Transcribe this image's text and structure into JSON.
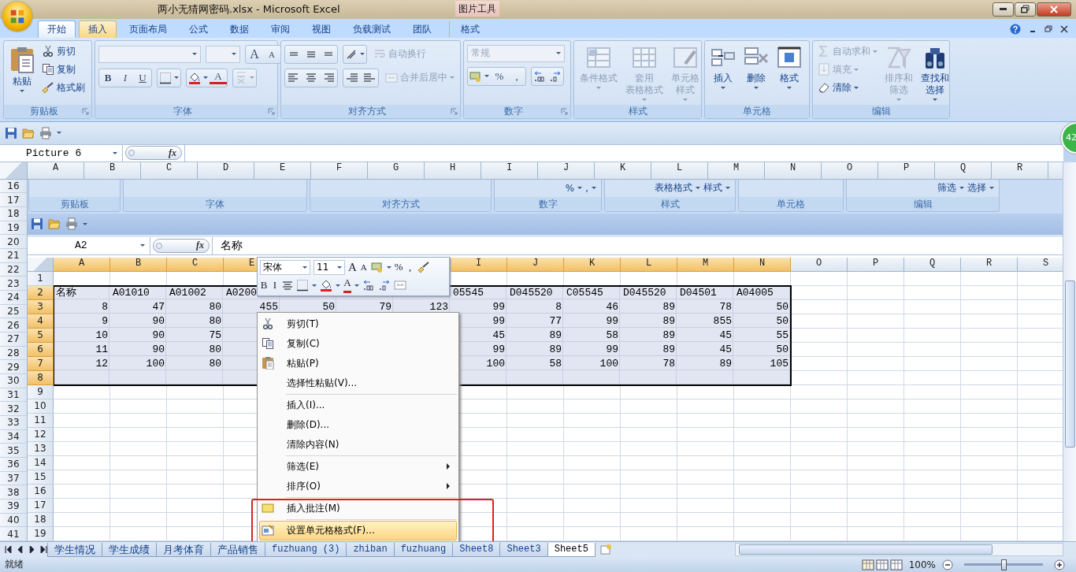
{
  "title_bar": {
    "title": "两小无猜网密码.xlsx - Microsoft Excel",
    "tool_label": "图片工具"
  },
  "tabs": [
    {
      "label": "开始",
      "selected": true,
      "hovered": false,
      "kind": "standard"
    },
    {
      "label": "插入",
      "selected": false,
      "hovered": true,
      "kind": "standard"
    },
    {
      "label": "页面布局",
      "selected": false,
      "hovered": false,
      "kind": "standard"
    },
    {
      "label": "公式",
      "selected": false,
      "hovered": false,
      "kind": "standard"
    },
    {
      "label": "数据",
      "selected": false,
      "hovered": false,
      "kind": "standard"
    },
    {
      "label": "审阅",
      "selected": false,
      "hovered": false,
      "kind": "standard"
    },
    {
      "label": "视图",
      "selected": false,
      "hovered": false,
      "kind": "standard"
    },
    {
      "label": "负载测试",
      "selected": false,
      "hovered": false,
      "kind": "standard"
    },
    {
      "label": "团队",
      "selected": false,
      "hovered": false,
      "kind": "standard"
    },
    {
      "label": "格式",
      "selected": false,
      "hovered": false,
      "kind": "contextual"
    }
  ],
  "ribbon": {
    "clipboard": {
      "label": "剪贴板",
      "paste": "粘贴",
      "items": [
        "剪切",
        "复制",
        "格式刷"
      ]
    },
    "font": {
      "label": "字体",
      "grow": "A",
      "shrink": "A",
      "bold": "B",
      "italic": "I",
      "underline": "U",
      "font_color_glyph": "A"
    },
    "alignment": {
      "label": "对齐方式",
      "buttons": [
        {
          "label": "自动换行",
          "disabled": true
        },
        {
          "label": "合并后居中",
          "disabled": true
        }
      ]
    },
    "number": {
      "label": "数字",
      "format": "常规",
      "percent": "%",
      "comma": ","
    },
    "styles": {
      "label": "样式",
      "buttons": [
        {
          "lines": [
            "条件格式"
          ],
          "disabled": true
        },
        {
          "lines": [
            "套用",
            "表格格式"
          ],
          "disabled": true
        },
        {
          "lines": [
            "单元格",
            "样式"
          ],
          "disabled": true
        }
      ]
    },
    "cells": {
      "label": "单元格",
      "buttons": [
        {
          "lines": [
            "插入"
          ],
          "disabled": false
        },
        {
          "lines": [
            "删除"
          ],
          "disabled": false
        },
        {
          "lines": [
            "格式"
          ],
          "disabled": false
        }
      ]
    },
    "editing": {
      "label": "编辑",
      "small": [
        {
          "label": "自动求和",
          "disabled": true
        },
        {
          "label": "填充",
          "disabled": true
        },
        {
          "label": "清除",
          "disabled": false
        }
      ],
      "buttons": [
        {
          "lines": [
            "排序和",
            "筛选"
          ],
          "disabled": true
        },
        {
          "lines": [
            "查找和",
            "选择"
          ],
          "disabled": false
        }
      ]
    }
  },
  "badge": "42",
  "formula_bar": {
    "name_box": "Picture 6",
    "function_label": "fx"
  },
  "sheet": {
    "columns": [
      "A",
      "B",
      "C",
      "D",
      "E",
      "F",
      "G",
      "H",
      "I",
      "J",
      "K",
      "L",
      "M",
      "N",
      "O",
      "P",
      "Q",
      "R"
    ],
    "rows": [
      "16",
      "17",
      "18",
      "19",
      "20",
      "21",
      "22",
      "23",
      "24",
      "25",
      "26",
      "27",
      "28",
      "29",
      "30",
      "31",
      "32",
      "33",
      "34",
      "35",
      "36",
      "37",
      "38",
      "39",
      "40",
      "41"
    ]
  },
  "picture": {
    "ribbon_fragment": [
      {
        "label": "剪贴板"
      },
      {
        "label": "字体"
      },
      {
        "label": "对齐方式"
      },
      {
        "label": "数字",
        "items": [
          "%",
          ","
        ]
      },
      {
        "label": "样式",
        "items": [
          "表格格式",
          "样式"
        ]
      },
      {
        "label": "单元格"
      },
      {
        "label": "编辑",
        "items": [
          "筛选",
          "选择"
        ]
      }
    ],
    "name_box": "A2",
    "function_label": "fx",
    "formula": "名称",
    "columns": [
      {
        "label": "A",
        "selected": true
      },
      {
        "label": "B",
        "selected": true
      },
      {
        "label": "C",
        "selected": true
      },
      {
        "label": "E",
        "selected": true
      },
      {
        "label": "I",
        "selected": true
      },
      {
        "label": "J",
        "selected": true
      },
      {
        "label": "K",
        "selected": true
      },
      {
        "label": "L",
        "selected": true
      },
      {
        "label": "M",
        "selected": true
      },
      {
        "label": "N",
        "selected": true
      },
      {
        "label": "O",
        "selected": false
      },
      {
        "label": "P",
        "selected": false
      },
      {
        "label": "Q",
        "selected": false
      },
      {
        "label": "R",
        "selected": false
      },
      {
        "label": "S",
        "selected": false
      }
    ],
    "rows": [
      {
        "label": "1",
        "selected": false
      },
      {
        "label": "2",
        "selected": true
      },
      {
        "label": "3",
        "selected": true
      },
      {
        "label": "4",
        "selected": true
      },
      {
        "label": "5",
        "selected": true
      },
      {
        "label": "6",
        "selected": true
      },
      {
        "label": "7",
        "selected": true
      },
      {
        "label": "8",
        "selected": true
      },
      {
        "label": "9",
        "selected": false
      },
      {
        "label": "10",
        "selected": false
      },
      {
        "label": "11",
        "selected": false
      },
      {
        "label": "12",
        "selected": false
      },
      {
        "label": "13",
        "selected": false
      },
      {
        "label": "14",
        "selected": false
      },
      {
        "label": "15",
        "selected": false
      },
      {
        "label": "16",
        "selected": false
      },
      {
        "label": "17",
        "selected": false
      },
      {
        "label": "18",
        "selected": false
      },
      {
        "label": "19",
        "selected": false
      }
    ],
    "cells": [
      {
        "kind": "text",
        "left_values": [
          "名称",
          "A01010",
          "A01002",
          "A0200"
        ],
        "right_values": [
          "05545",
          "D045520",
          "C05545",
          "D045520",
          "D04501",
          "A04005"
        ]
      },
      {
        "kind": "number",
        "left_values": [
          "8",
          "47",
          "80",
          "455",
          "50",
          "79",
          "123"
        ],
        "right_values": [
          "99",
          "8",
          "46",
          "89",
          "78",
          "50"
        ]
      },
      {
        "kind": "number",
        "left_values": [
          "9",
          "90",
          "80"
        ],
        "right_values": [
          "99",
          "77",
          "99",
          "89",
          "855",
          "50"
        ]
      },
      {
        "kind": "number",
        "left_values": [
          "10",
          "90",
          "75"
        ],
        "right_values": [
          "45",
          "89",
          "58",
          "89",
          "45",
          "55"
        ]
      },
      {
        "kind": "number",
        "left_values": [
          "11",
          "90",
          "80"
        ],
        "right_values": [
          "99",
          "89",
          "99",
          "89",
          "45",
          "50"
        ]
      },
      {
        "kind": "number",
        "left_values": [
          "12",
          "100",
          "80"
        ],
        "right_values": [
          "100",
          "58",
          "100",
          "78",
          "89",
          "105"
        ]
      }
    ],
    "mini_toolbar": {
      "font": "宋体",
      "size": "11",
      "grow": "A",
      "shrink": "A",
      "percent": "%",
      "comma": ",",
      "bold": "B",
      "italic": "I",
      "font_color_glyph": "A"
    },
    "context_menu": [
      {
        "kind": "item",
        "label": "剪切(T)",
        "highlighted": false,
        "submenu": false
      },
      {
        "kind": "item",
        "label": "复制(C)",
        "highlighted": false,
        "submenu": false
      },
      {
        "kind": "item",
        "label": "粘贴(P)",
        "highlighted": false,
        "submenu": false
      },
      {
        "kind": "item",
        "label": "选择性粘贴(V)...",
        "highlighted": false,
        "submenu": false
      },
      {
        "kind": "separator"
      },
      {
        "kind": "item",
        "label": "插入(I)...",
        "highlighted": false,
        "submenu": false
      },
      {
        "kind": "item",
        "label": "删除(D)...",
        "highlighted": false,
        "submenu": false
      },
      {
        "kind": "item",
        "label": "清除内容(N)",
        "highlighted": false,
        "submenu": false
      },
      {
        "kind": "separator"
      },
      {
        "kind": "item",
        "label": "筛选(E)",
        "highlighted": false,
        "submenu": true
      },
      {
        "kind": "item",
        "label": "排序(O)",
        "highlighted": false,
        "submenu": true
      },
      {
        "kind": "separator"
      },
      {
        "kind": "item",
        "label": "插入批注(M)",
        "highlighted": false,
        "submenu": false
      },
      {
        "kind": "separator"
      },
      {
        "kind": "item",
        "label": "设置单元格格式(F)...",
        "highlighted": true,
        "submenu": false
      }
    ]
  },
  "sheet_tabs": [
    {
      "label": "学生情况",
      "selected": false
    },
    {
      "label": "学生成绩",
      "selected": false
    },
    {
      "label": "月考体育",
      "selected": false
    },
    {
      "label": "产品销售",
      "selected": false
    },
    {
      "label": "fuzhuang (3)",
      "selected": false
    },
    {
      "label": "zhiban",
      "selected": false
    },
    {
      "label": "fuzhuang",
      "selected": false
    },
    {
      "label": "Sheet8",
      "selected": false
    },
    {
      "label": "Sheet3",
      "selected": false
    },
    {
      "label": "Sheet5",
      "selected": true
    }
  ],
  "status_bar": {
    "status": "就绪",
    "zoom": "100%",
    "level": 0.5
  }
}
